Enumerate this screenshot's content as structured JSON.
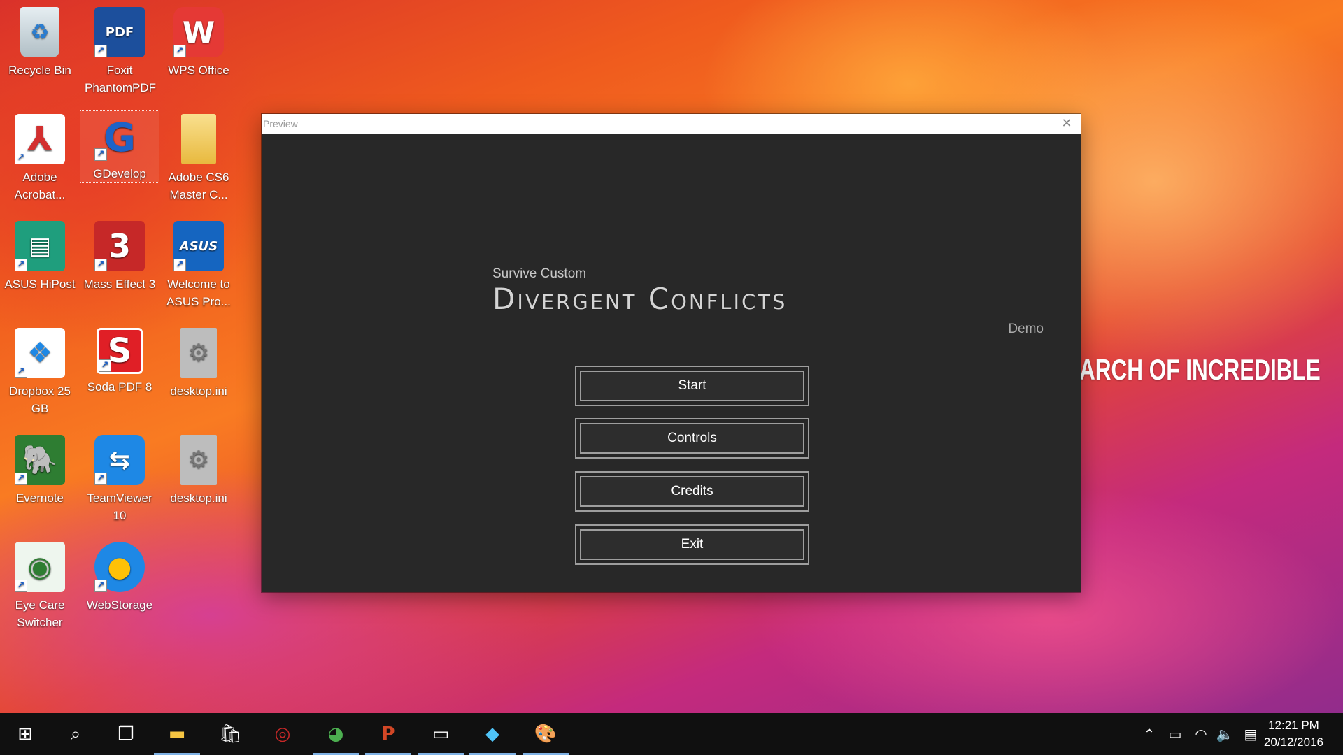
{
  "desktop": {
    "icons": [
      {
        "label": "Recycle Bin",
        "icon": "recycle-bin-icon",
        "color": "#cfd8dc"
      },
      {
        "label": "Foxit PhantomPDF",
        "icon": "foxit-pdf-icon",
        "color": "#1c4f9c"
      },
      {
        "label": "WPS Office",
        "icon": "wps-office-icon",
        "color": "#e53935"
      },
      {
        "label": "Adobe Acrobat...",
        "icon": "adobe-acrobat-icon",
        "color": "#ffffff"
      },
      {
        "label": "GDevelop",
        "icon": "gdevelop-icon",
        "color": "#1e63c7"
      },
      {
        "label": "Adobe CS6 Master C...",
        "icon": "folder-icon",
        "color": "#f5d26b"
      },
      {
        "label": "ASUS HiPost",
        "icon": "asus-hipost-icon",
        "color": "#1f9e7d"
      },
      {
        "label": "Mass Effect 3",
        "icon": "mass-effect-icon",
        "color": "#c62828"
      },
      {
        "label": "Welcome to ASUS Pro...",
        "icon": "asus-icon",
        "color": "#1565c0"
      },
      {
        "label": "Dropbox 25 GB",
        "icon": "dropbox-icon",
        "color": "#ffffff"
      },
      {
        "label": "Soda PDF 8",
        "icon": "soda-pdf-icon",
        "color": "#e01f26"
      },
      {
        "label": "desktop.ini",
        "icon": "settings-file-icon",
        "color": "#bdbdbd"
      },
      {
        "label": "Evernote",
        "icon": "evernote-icon",
        "color": "#2e7d32"
      },
      {
        "label": "TeamViewer 10",
        "icon": "teamviewer-icon",
        "color": "#1e88e5"
      },
      {
        "label": "desktop.ini",
        "icon": "settings-file-icon",
        "color": "#bdbdbd"
      },
      {
        "label": "Eye Care Switcher",
        "icon": "eye-care-icon",
        "color": "#e8f5e9"
      },
      {
        "label": "WebStorage",
        "icon": "webstorage-icon",
        "color": "#1e88e5"
      }
    ],
    "wallpaper_text": "ARCH OF INCREDIBLE"
  },
  "window": {
    "title": "Preview",
    "close_icon": "close-icon"
  },
  "game": {
    "subtitle": "Survive Custom",
    "title": "Divergent Conflicts",
    "edition": "Demo",
    "menu": [
      "Start",
      "Controls",
      "Credits",
      "Exit"
    ]
  },
  "taskbar": {
    "items": [
      "start-icon",
      "search-icon",
      "task-view-icon",
      "file-explorer-icon",
      "store-icon",
      "asus-app-icon",
      "chrome-icon",
      "powerpoint-icon",
      "monitor-app-icon",
      "paint3d-icon",
      "gdevelop-palette-icon"
    ],
    "tray": [
      "chevron-up-icon",
      "battery-icon",
      "wifi-icon",
      "volume-icon",
      "notifications-icon"
    ],
    "time": "12:21 PM",
    "date": "20/12/2016"
  }
}
